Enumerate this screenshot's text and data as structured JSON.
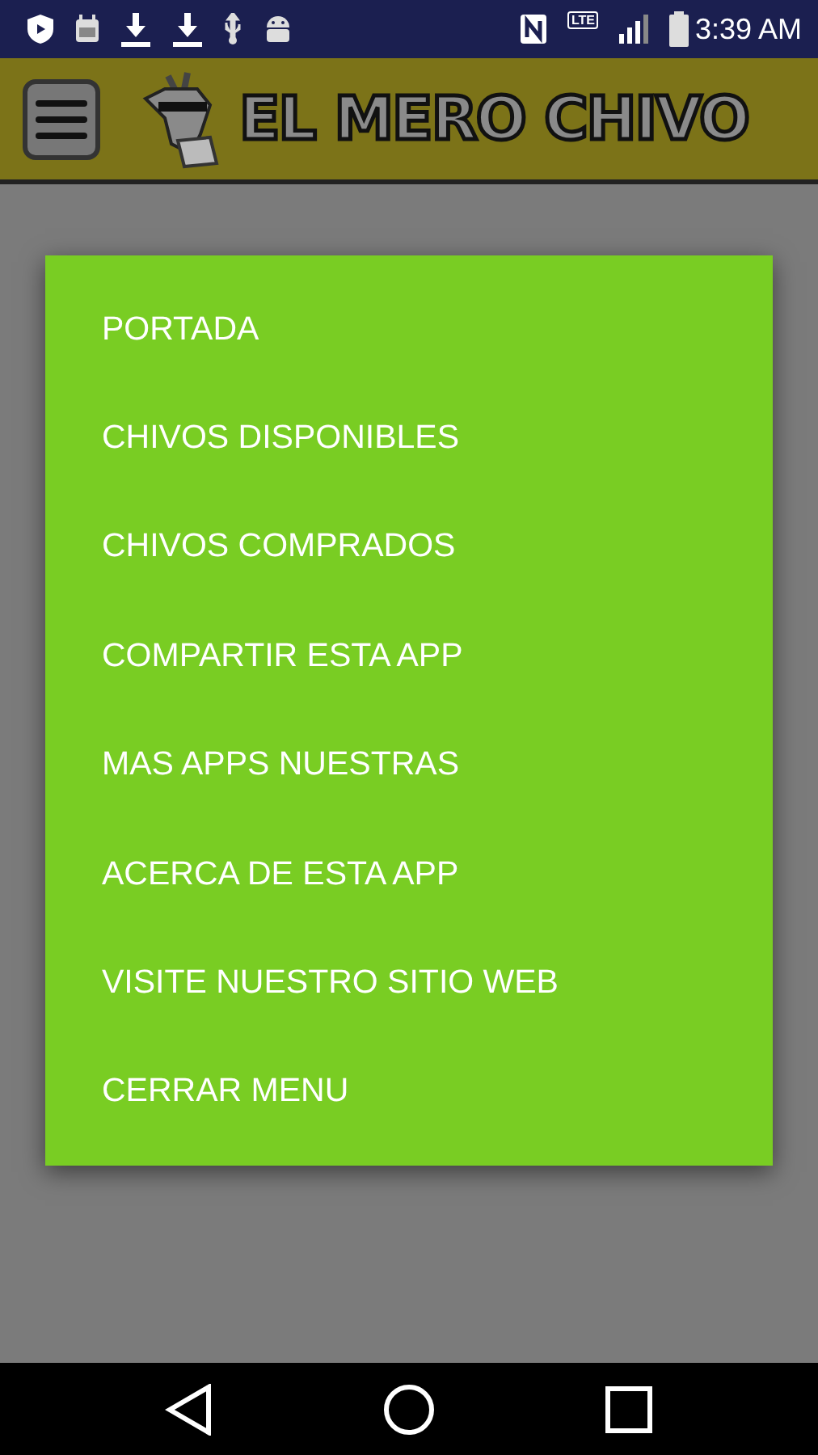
{
  "status_bar": {
    "network_type": "LTE",
    "time": "3:39 AM"
  },
  "header": {
    "title": "EL MERO CHIVO"
  },
  "menu": {
    "items": [
      {
        "label": "PORTADA"
      },
      {
        "label": "CHIVOS DISPONIBLES"
      },
      {
        "label": "CHIVOS COMPRADOS"
      },
      {
        "label": "COMPARTIR ESTA APP"
      },
      {
        "label": "MAS APPS NUESTRAS"
      },
      {
        "label": "ACERCA DE ESTA APP"
      },
      {
        "label": "VISITE NUESTRO SITIO WEB"
      },
      {
        "label": "CERRAR MENU"
      }
    ]
  }
}
